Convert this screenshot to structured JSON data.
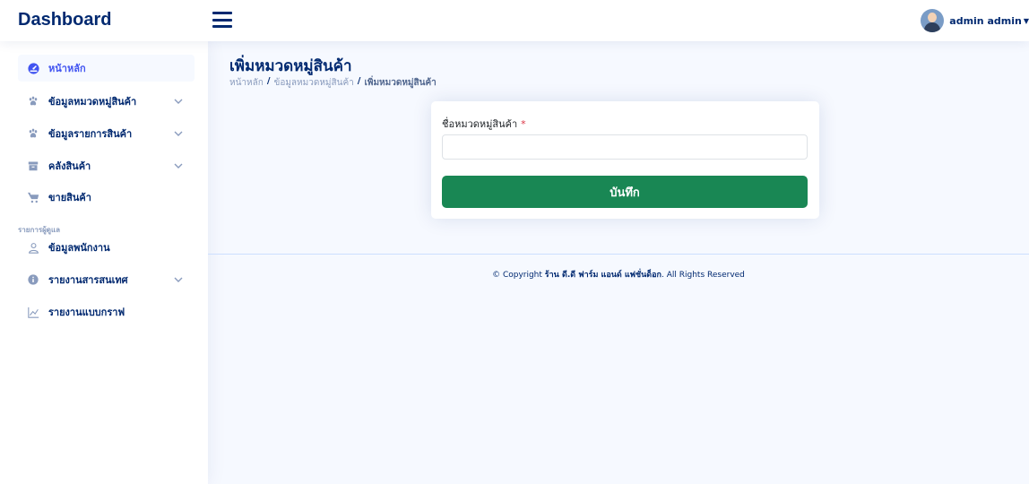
{
  "header": {
    "logo": "Dashboard",
    "user_name": "admin admin"
  },
  "sidebar": {
    "items": [
      {
        "label": "หน้าหลัก",
        "icon": "dashboard-gauge-icon",
        "active": true,
        "expandable": false
      },
      {
        "label": "ข้อมูลหมวดหมู่สินค้า",
        "icon": "paw-icon",
        "expandable": true
      },
      {
        "label": "ข้อมูลรายการสินค้า",
        "icon": "paw-icon",
        "expandable": true
      },
      {
        "label": "คลังสินค้า",
        "icon": "archive-icon",
        "expandable": true
      },
      {
        "label": "ขายสินค้า",
        "icon": "cart-icon",
        "expandable": false
      }
    ],
    "heading": "รายการผู้ดูแล",
    "items2": [
      {
        "label": "ข้อมูลพนักงาน",
        "icon": "person-icon",
        "expandable": false
      },
      {
        "label": "รายงานสารสนเทศ",
        "icon": "info-circle-icon",
        "expandable": true
      },
      {
        "label": "รายงานแบบกราฟ",
        "icon": "graph-icon",
        "expandable": false
      }
    ]
  },
  "main": {
    "title": "เพิ่มหมวดหมู่สินค้า",
    "breadcrumb": {
      "home": "หน้าหลัก",
      "section": "ข้อมูลหมวดหมู่สินค้า",
      "current": "เพิ่มหมวดหมู่สินค้า",
      "separator": "/"
    },
    "form": {
      "field_label": "ชื่อหมวดหมู่สินค้า",
      "required_mark": "*",
      "field_value": "",
      "save_label": "บันทึก"
    }
  },
  "footer": {
    "prefix": "© Copyright",
    "shop": "ร้าน ดี.ดี ฟาร์ม แอนด์ แฟชั่นด็อก",
    "suffix": ". All Rights Reserved"
  },
  "colors": {
    "brand": "#012970",
    "accent": "#4154f1",
    "save_button": "#198754",
    "background": "#f6f9ff"
  }
}
